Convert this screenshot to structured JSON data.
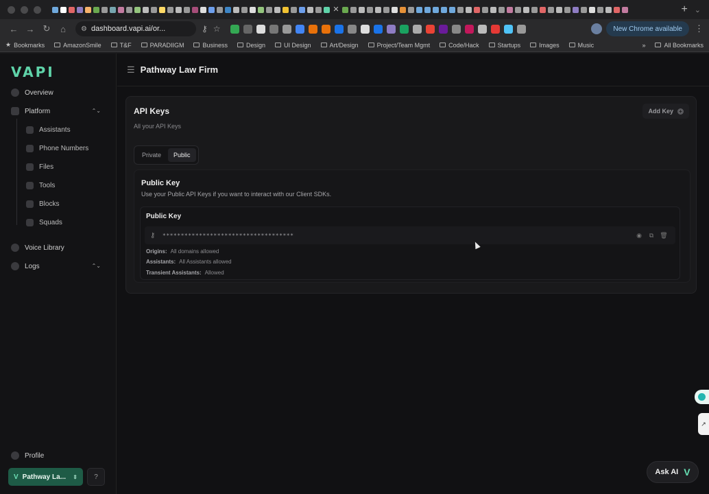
{
  "browser": {
    "url": "dashboard.vapi.ai/or...",
    "update_label": "New Chrome available",
    "bookmarks": [
      "Bookmarks",
      "AmazonSmile",
      "T&F",
      "PARADIIGM",
      "Business",
      "Design",
      "UI Design",
      "Art/Design",
      "Project/Team Mgmt",
      "Code/Hack",
      "Startups",
      "Images",
      "Music"
    ],
    "all_bookmarks": "All Bookmarks"
  },
  "sidebar": {
    "logo": "VAPI",
    "overview": "Overview",
    "platform": "Platform",
    "platform_items": [
      "Assistants",
      "Phone Numbers",
      "Files",
      "Tools",
      "Blocks",
      "Squads"
    ],
    "voice_library": "Voice Library",
    "logs": "Logs",
    "profile": "Profile",
    "org_name": "Pathway La..."
  },
  "header": {
    "title": "Pathway Law Firm"
  },
  "api_keys": {
    "title": "API Keys",
    "subtitle": "All your API Keys",
    "add_key": "Add Key",
    "tabs": [
      "Private",
      "Public"
    ],
    "selected_tab": "Public",
    "section_title": "Public Key",
    "section_desc": "Use your Public API Keys if you want to interact with our Client SDKs.",
    "key_card": {
      "title": "Public Key",
      "masked_value": "************************************",
      "origins_label": "Origins:",
      "origins_value": "All domains allowed",
      "assistants_label": "Assistants:",
      "assistants_value": "All Assistants allowed",
      "transient_label": "Transient Assistants:",
      "transient_value": "Allowed"
    }
  },
  "ask_ai": "Ask AI",
  "colors": {
    "brand": "#5fd3a9",
    "org_button": "#1e5b46",
    "background": "#111113"
  }
}
